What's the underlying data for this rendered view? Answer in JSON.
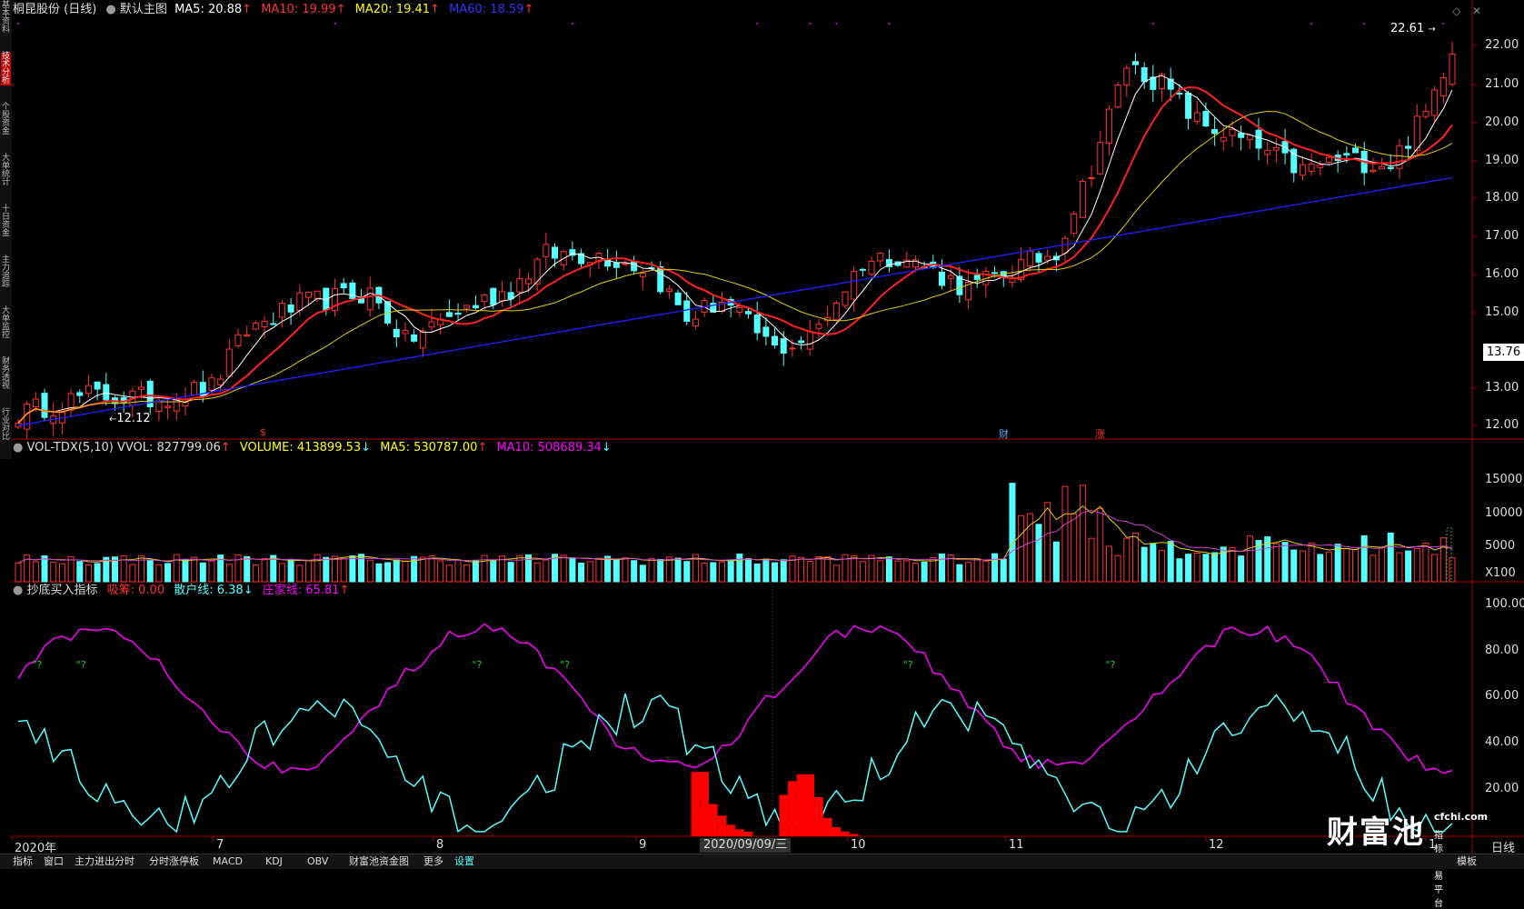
{
  "main_panel": {
    "stock_title": "桐昆股份 (日线)",
    "template": "默认主图",
    "ma5": "MA5: 20.88",
    "ma10": "MA10: 19.99",
    "ma20": "MA20: 19.41",
    "ma60": "MA60: 18.59",
    "up_arrow": "↑",
    "price_axis": [
      "22.00",
      "21.00",
      "20.00",
      "19.00",
      "18.00",
      "17.00",
      "16.00",
      "15.00",
      "13.00",
      "12.00"
    ],
    "current_price_tag": "13.76",
    "high_label": "22.61",
    "low_label": "12.12",
    "markers": [
      "$",
      "财",
      "涨"
    ]
  },
  "vol_panel": {
    "name": "VOL-TDX(5,10)",
    "vvol": "VVOL: 827799.06",
    "volume": "VOLUME: 413899.53",
    "ma5": "MA5: 530787.00",
    "ma10": "MA10: 508689.34",
    "up_arrow": "↑",
    "down_arrow": "↓",
    "axis": [
      "15000",
      "10000",
      "5000",
      "X100"
    ]
  },
  "indicator_panel": {
    "name": "抄底买入指标",
    "xichou": "吸筹: 0.00",
    "sanhu": "散户线: 6.38",
    "zhuangjia": "庄家线: 65.81",
    "up_arrow": "↑",
    "down_arrow": "↓",
    "axis": [
      "100.00",
      "80.00",
      "60.00",
      "40.00",
      "20.00"
    ],
    "signal": "\"?"
  },
  "x_axis": {
    "labels": [
      "2020年",
      "7",
      "8",
      "9",
      "10",
      "11",
      "12",
      "1"
    ],
    "date_cursor": "2020/09/09/三",
    "period": "日线"
  },
  "sidebar": {
    "tabs": [
      "基本资料",
      "技术分析",
      "个股资金",
      "大单统计",
      "十日资金",
      "主力追踪",
      "大单监控",
      "财务透视",
      "行业对比"
    ],
    "active_index": 1
  },
  "bottom_bar": {
    "items": [
      "指标",
      "窗口",
      "主力进出分时",
      "分时涨停板",
      "MACD",
      "KDJ",
      "OBV",
      "财富池资金图",
      "更多",
      "设置"
    ],
    "active": "设置",
    "right_item": "模板"
  },
  "logo": {
    "main": "财富池",
    "site": "cfchi.com",
    "tagline": "指标交易平台"
  },
  "colors": {
    "up": "#ff3232",
    "down": "#54ffff",
    "ma5": "#ffffff",
    "ma10": "#ff2020",
    "ma20": "#ffff00",
    "ma60": "#0000ff",
    "zhuangjia": "#ff00ff",
    "sanhu": "#54ffff",
    "xichou": "#ff0000",
    "vol_ma5": "#ffff00",
    "vol_ma10": "#ff00ff"
  }
}
